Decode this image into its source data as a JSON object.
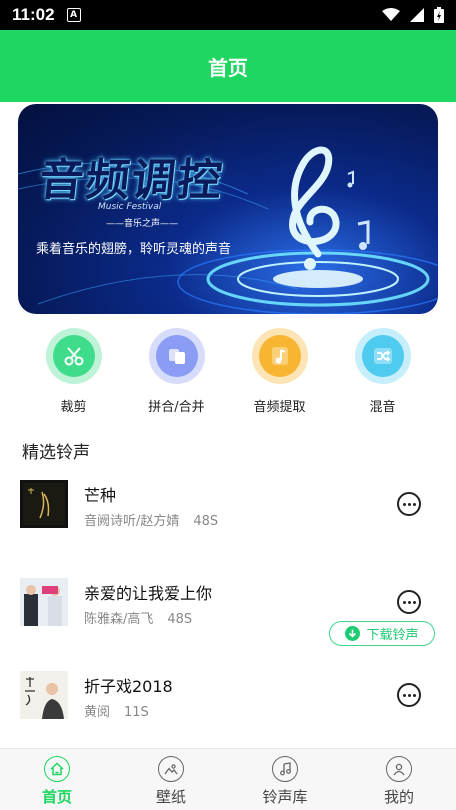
{
  "status_bar": {
    "time": "11:02",
    "a_icon": "A"
  },
  "header": {
    "title": "首页"
  },
  "banner": {
    "title": "音频调控",
    "music_text": "Music Festival",
    "subtitle_small": "——音乐之声——",
    "subtitle": "乘着音乐的翅膀，聆听灵魂的声音"
  },
  "features": [
    {
      "label": "裁剪",
      "icon": "scissors-icon",
      "color_outer": "#bff3d8",
      "color_inner": "#3fdc8c"
    },
    {
      "label": "拼合/合并",
      "icon": "merge-icon",
      "color_outer": "#d7dcfb",
      "color_inner": "#8a9cf3"
    },
    {
      "label": "音频提取",
      "icon": "music-note-icon",
      "color_outer": "#fde4b5",
      "color_inner": "#f7b531"
    },
    {
      "label": "混音",
      "icon": "shuffle-icon",
      "color_outer": "#c7eefb",
      "color_inner": "#4fcbf0"
    }
  ],
  "section": {
    "title": "精选铃声"
  },
  "songs": [
    {
      "title": "芒种",
      "artist": "音阙诗听/赵方婧",
      "duration": "48S"
    },
    {
      "title": "亲爱的让我爱上你",
      "artist": "陈雅森/高飞",
      "duration": "48S"
    },
    {
      "title": "折子戏2018",
      "artist": "黄阅",
      "duration": "11S"
    }
  ],
  "download": {
    "label": "下载铃声"
  },
  "tabs": [
    {
      "label": "首页",
      "icon": "home-icon",
      "active": true
    },
    {
      "label": "壁纸",
      "icon": "image-icon",
      "active": false
    },
    {
      "label": "铃声库",
      "icon": "music-note-icon",
      "active": false
    },
    {
      "label": "我的",
      "icon": "user-icon",
      "active": false
    }
  ],
  "colors": {
    "primary": "#1ed660",
    "download_green": "#1ccb72"
  }
}
